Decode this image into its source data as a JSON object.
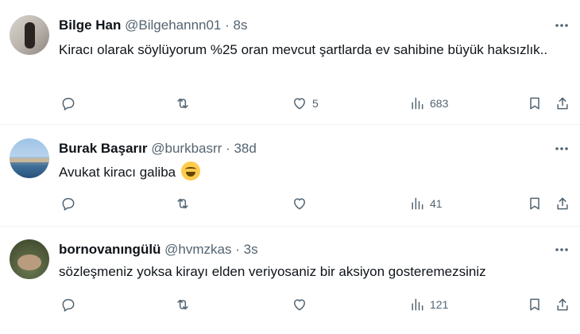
{
  "tweets": [
    {
      "name": "Bilge Han",
      "handle": "@Bilgehannn01",
      "separator": "·",
      "time": "8s",
      "text": "Kiracı olarak söylüyorum %25 oran mevcut şartlarda ev sahibine büyük haksızlık..",
      "emoji": "",
      "likes": "5",
      "views": "683"
    },
    {
      "name": "Burak Başarır",
      "handle": "@burkbasrr",
      "separator": "·",
      "time": "38d",
      "text": "Avukat kiracı galiba ",
      "emoji": "tears-of-joy-emoji",
      "likes": "",
      "views": "41"
    },
    {
      "name": "bornovanıngülü",
      "handle": "@hvmzkas",
      "separator": "·",
      "time": "3s",
      "text": "sözleşmeniz yoksa kirayı elden veriyosaniz bir aksiyon gosteremezsiniz",
      "emoji": "",
      "likes": "",
      "views": "121"
    }
  ],
  "icons": {
    "reply": "reply-icon",
    "retweet": "retweet-icon",
    "like": "heart-icon",
    "views": "views-icon",
    "bookmark": "bookmark-icon",
    "share": "share-icon",
    "more": "more-icon"
  },
  "colors": {
    "text": "#0f1419",
    "secondary": "#536471",
    "divider": "#eff3f4"
  }
}
